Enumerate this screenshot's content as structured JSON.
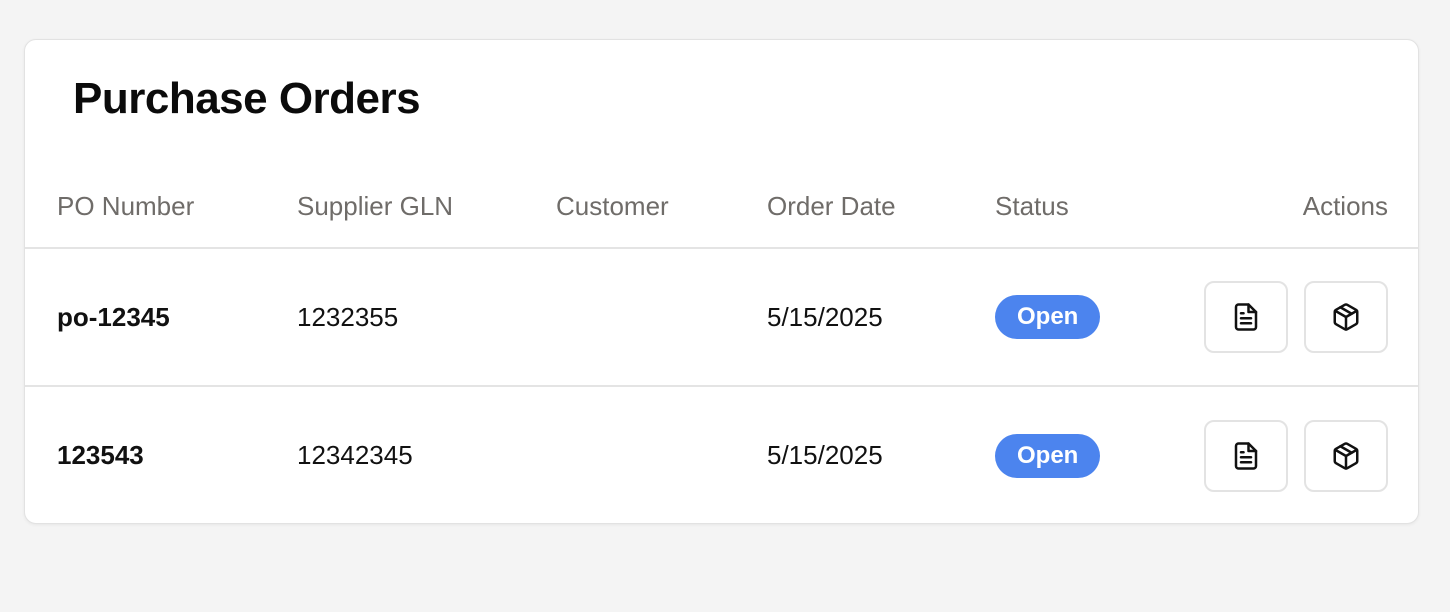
{
  "page": {
    "title": "Purchase Orders"
  },
  "table": {
    "headers": {
      "po_number": "PO Number",
      "supplier_gln": "Supplier GLN",
      "customer": "Customer",
      "order_date": "Order Date",
      "status": "Status",
      "actions": "Actions"
    },
    "rows": [
      {
        "po_number": "po-12345",
        "supplier_gln": "1232355",
        "customer": "",
        "order_date": "5/15/2025",
        "status": "Open"
      },
      {
        "po_number": "123543",
        "supplier_gln": "12342345",
        "customer": "",
        "order_date": "5/15/2025",
        "status": "Open"
      }
    ]
  },
  "icons": {
    "document_action": "file-text-icon",
    "package_action": "package-icon"
  },
  "colors": {
    "status_open": "#4c84ee",
    "background": "#f4f4f4",
    "header_text": "#6f6c69"
  }
}
